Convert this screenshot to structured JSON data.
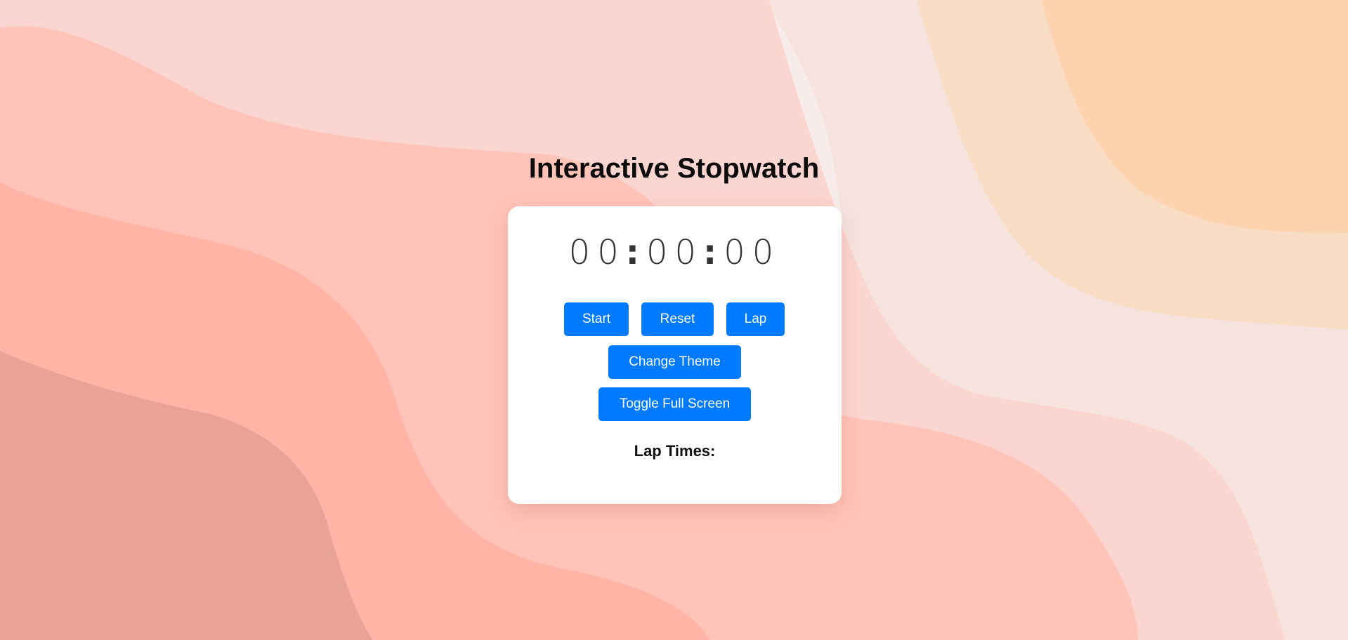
{
  "page": {
    "title": "Interactive Stopwatch"
  },
  "stopwatch": {
    "hours": "00",
    "minutes": "00",
    "seconds": "00",
    "separator": ":"
  },
  "controls": {
    "start_label": "Start",
    "reset_label": "Reset",
    "lap_label": "Lap",
    "theme_label": "Change Theme",
    "fullscreen_label": "Toggle Full Screen"
  },
  "laps": {
    "heading": "Lap Times:",
    "items": []
  },
  "colors": {
    "button": "#007bff",
    "card": "#ffffff",
    "wave_light": "#fbd5cf",
    "wave_mid": "#ffc3b8",
    "wave_dark": "#ffb4a6",
    "wave_deep": "#e8a396",
    "peach": "#fcd3ae"
  }
}
